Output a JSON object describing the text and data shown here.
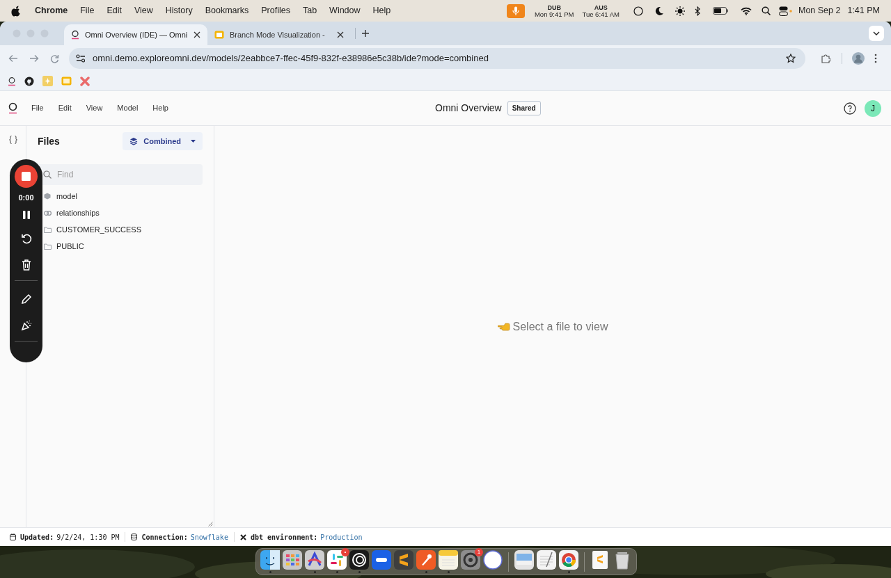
{
  "menubar": {
    "app": "Chrome",
    "items": [
      "File",
      "Edit",
      "View",
      "History",
      "Bookmarks",
      "Profiles",
      "Tab",
      "Window",
      "Help"
    ],
    "clocks": [
      {
        "city": "DUB",
        "time": "Mon 9:41 PM"
      },
      {
        "city": "AUS",
        "time": "Tue 6:41 AM"
      }
    ],
    "date": "Mon Sep 2",
    "time": "1:41 PM"
  },
  "browser": {
    "tabs": [
      {
        "title": "Omni Overview (IDE) — Omni",
        "kind": "omni",
        "selected": true
      },
      {
        "title": "Branch Mode Visualization -",
        "kind": "slides",
        "selected": false
      }
    ],
    "url": "omni.demo.exploreomni.dev/models/2eabbce7-ffec-45f9-832f-e38986e5c38b/ide?mode=combined"
  },
  "app": {
    "menu": [
      "File",
      "Edit",
      "View",
      "Model",
      "Help"
    ],
    "title": "Omni Overview",
    "badge": "Shared",
    "avatar": "J",
    "sidebar": {
      "title": "Files",
      "mode": "Combined",
      "search_placeholder": "Find",
      "files": [
        {
          "name": "model",
          "kind": "model"
        },
        {
          "name": "relationships",
          "kind": "link"
        },
        {
          "name": "CUSTOMER_SUCCESS",
          "kind": "folder"
        },
        {
          "name": "PUBLIC",
          "kind": "folder"
        }
      ]
    },
    "empty_message": "Select a file to view"
  },
  "recorder": {
    "time": "0:00"
  },
  "status_bar": [
    {
      "kind": "calendar",
      "label": "Updated:",
      "value": "9/2/24, 1:30 PM",
      "link": false
    },
    {
      "kind": "database",
      "label": "Connection:",
      "value": "Snowflake",
      "link": true
    },
    {
      "kind": "dbt",
      "label": "dbt environment:",
      "value": "Production",
      "link": true
    }
  ],
  "dock": [
    {
      "kind": "finder",
      "running": true
    },
    {
      "kind": "launchpad",
      "running": false
    },
    {
      "kind": "affinity",
      "running": true
    },
    {
      "kind": "slack",
      "running": true,
      "badge": "•"
    },
    {
      "kind": "rings",
      "running": true
    },
    {
      "kind": "zoom",
      "running": false
    },
    {
      "kind": "sublime",
      "running": false
    },
    {
      "kind": "postman",
      "running": true
    },
    {
      "kind": "notes",
      "running": true
    },
    {
      "kind": "settings",
      "running": false,
      "badge": "1"
    },
    {
      "kind": "circle",
      "running": false
    },
    {
      "kind": "sep"
    },
    {
      "kind": "preview",
      "running": false
    },
    {
      "kind": "textedit",
      "running": false
    },
    {
      "kind": "chrome",
      "running": true
    },
    {
      "kind": "sep"
    },
    {
      "kind": "doc",
      "running": false
    },
    {
      "kind": "trash",
      "running": false
    }
  ]
}
